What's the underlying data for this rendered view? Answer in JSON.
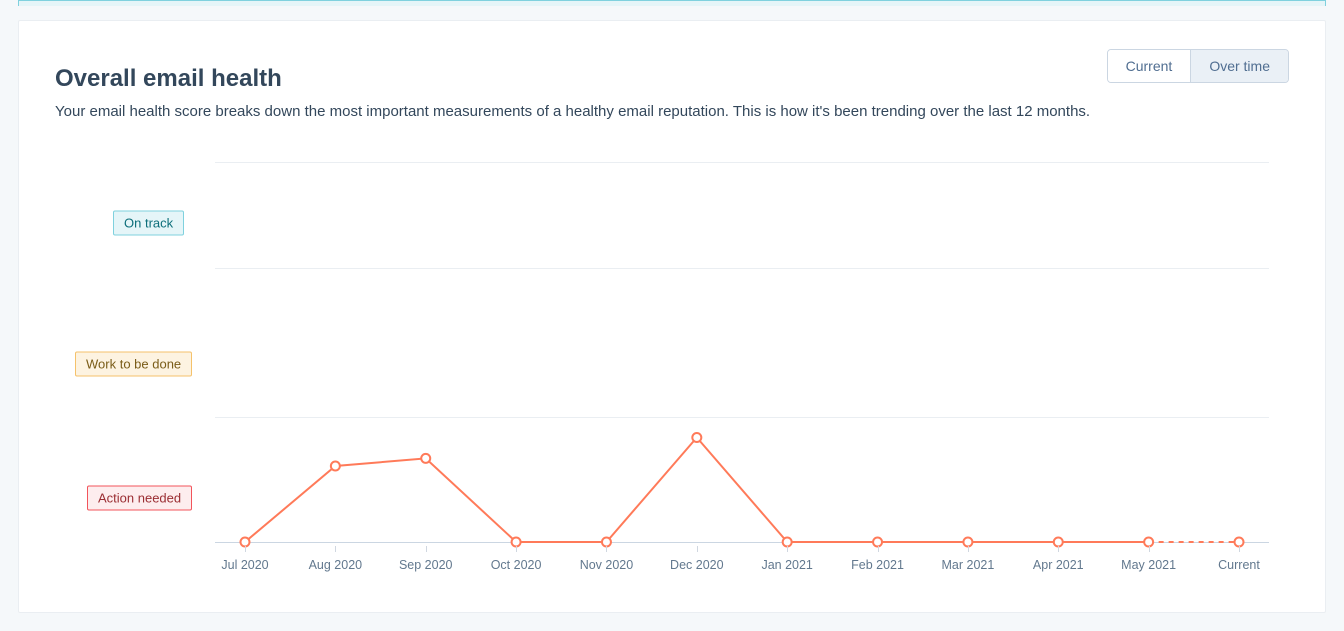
{
  "header": {
    "title": "Overall email health",
    "subtitle": "Your email health score breaks down the most important measurements of a healthy email reputation. This is how it's been trending over the last 12 months."
  },
  "toggle": {
    "current_label": "Current",
    "over_time_label": "Over time",
    "active": "over_time"
  },
  "yaxis": {
    "on_track": "On track",
    "work_to_be_done": "Work to be done",
    "action_needed": "Action needed"
  },
  "chart_data": {
    "type": "line",
    "ylabel": "",
    "xlabel": "",
    "y_levels": [
      "On track",
      "Work to be done",
      "Action needed"
    ],
    "y_numeric_map": {
      "On track": 3,
      "Work to be done": 2,
      "Action needed": 1
    },
    "categories": [
      "Jul 2020",
      "Aug 2020",
      "Sep 2020",
      "Oct 2020",
      "Nov 2020",
      "Dec 2020",
      "Jan 2021",
      "Feb 2021",
      "Mar 2021",
      "Apr 2021",
      "May 2021",
      "Current"
    ],
    "values": [
      0,
      0.8,
      0.88,
      0,
      0,
      1.1,
      0,
      0,
      0,
      0,
      0,
      0
    ],
    "segment_dashed_after_index": 10,
    "colors": {
      "line": "#ff7a59",
      "point_fill": "#ffffff",
      "point_stroke": "#ff7a59"
    }
  }
}
